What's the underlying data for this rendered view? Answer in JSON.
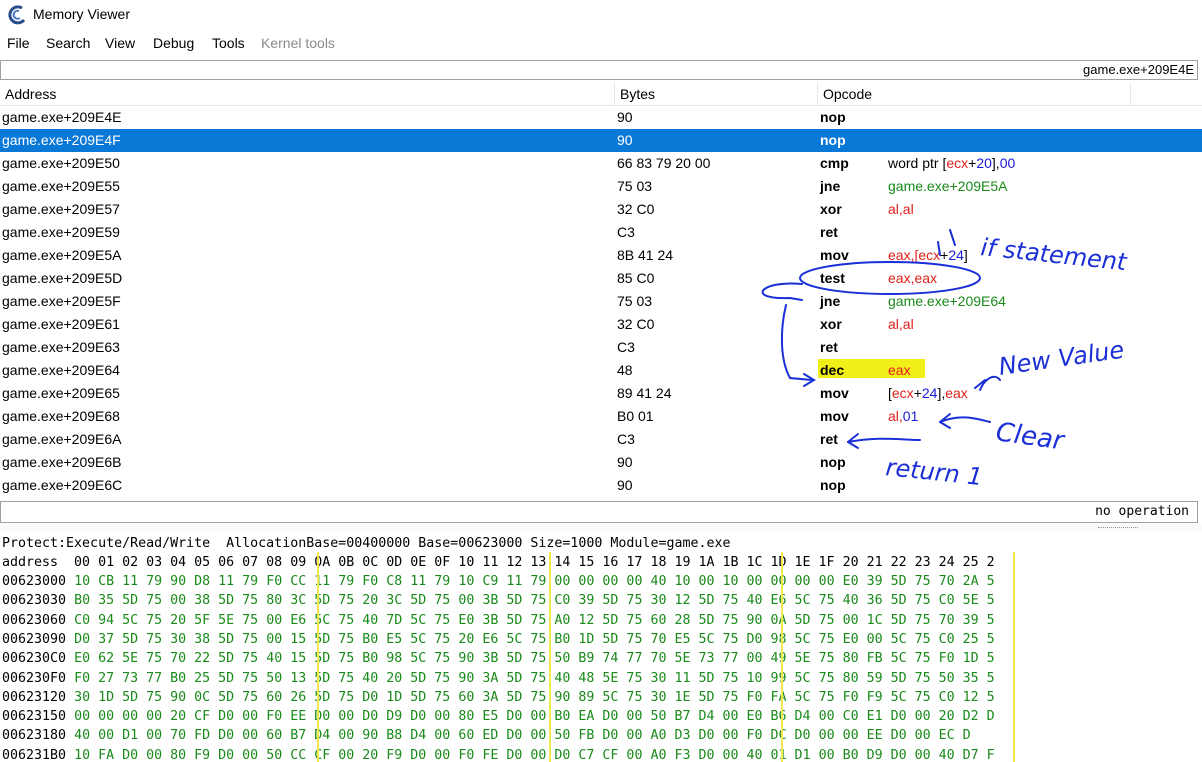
{
  "window": {
    "title": "Memory Viewer"
  },
  "menu": [
    "File",
    "Search",
    "View",
    "Debug",
    "Tools",
    "Kernel tools"
  ],
  "address_bar": {
    "value": "game.exe+209E4E"
  },
  "columns": {
    "address": "Address",
    "bytes": "Bytes",
    "opcode": "Opcode"
  },
  "disasm": [
    {
      "addr": "game.exe+209E4E",
      "bytes": "90",
      "op": "nop",
      "args": []
    },
    {
      "addr": "game.exe+209E4F",
      "bytes": "90",
      "op": "nop",
      "args": [],
      "selected": true
    },
    {
      "addr": "game.exe+209E50",
      "bytes": "66 83 79 20 00",
      "op": "cmp",
      "args": [
        {
          "t": "word ptr [",
          "c": ""
        },
        {
          "t": "ecx",
          "c": "red"
        },
        {
          "t": "+",
          "c": ""
        },
        {
          "t": "20",
          "c": "blue"
        },
        {
          "t": "],",
          "c": ""
        },
        {
          "t": "00",
          "c": "blue"
        }
      ]
    },
    {
      "addr": "game.exe+209E55",
      "bytes": "75 03",
      "op": "jne",
      "args": [
        {
          "t": "game.exe+209E5A",
          "c": "green"
        }
      ]
    },
    {
      "addr": "game.exe+209E57",
      "bytes": "32 C0",
      "op": "xor",
      "args": [
        {
          "t": "al,al",
          "c": "red"
        }
      ]
    },
    {
      "addr": "game.exe+209E59",
      "bytes": "C3",
      "op": "ret",
      "args": []
    },
    {
      "addr": "game.exe+209E5A",
      "bytes": "8B 41 24",
      "op": "mov",
      "args": [
        {
          "t": "eax,[",
          "c": "red"
        },
        {
          "t": "ecx",
          "c": "red"
        },
        {
          "t": "+",
          "c": ""
        },
        {
          "t": "24",
          "c": "blue"
        },
        {
          "t": "]",
          "c": ""
        }
      ]
    },
    {
      "addr": "game.exe+209E5D",
      "bytes": "85 C0",
      "op": "test",
      "args": [
        {
          "t": "eax,eax",
          "c": "red"
        }
      ]
    },
    {
      "addr": "game.exe+209E5F",
      "bytes": "75 03",
      "op": "jne",
      "args": [
        {
          "t": "game.exe+209E64",
          "c": "green"
        }
      ]
    },
    {
      "addr": "game.exe+209E61",
      "bytes": "32 C0",
      "op": "xor",
      "args": [
        {
          "t": "al,al",
          "c": "red"
        }
      ]
    },
    {
      "addr": "game.exe+209E63",
      "bytes": "C3",
      "op": "ret",
      "args": []
    },
    {
      "addr": "game.exe+209E64",
      "bytes": "48",
      "op": "dec",
      "args": [
        {
          "t": "eax",
          "c": "red"
        }
      ],
      "highlight": true
    },
    {
      "addr": "game.exe+209E65",
      "bytes": "89 41 24",
      "op": "mov",
      "args": [
        {
          "t": "[",
          "c": ""
        },
        {
          "t": "ecx",
          "c": "red"
        },
        {
          "t": "+",
          "c": ""
        },
        {
          "t": "24",
          "c": "blue"
        },
        {
          "t": "],",
          "c": ""
        },
        {
          "t": "eax",
          "c": "red"
        }
      ]
    },
    {
      "addr": "game.exe+209E68",
      "bytes": "B0 01",
      "op": "mov",
      "args": [
        {
          "t": "al,",
          "c": "red"
        },
        {
          "t": "01",
          "c": "blue"
        }
      ]
    },
    {
      "addr": "game.exe+209E6A",
      "bytes": "C3",
      "op": "ret",
      "args": []
    },
    {
      "addr": "game.exe+209E6B",
      "bytes": "90",
      "op": "nop",
      "args": []
    },
    {
      "addr": "game.exe+209E6C",
      "bytes": "90",
      "op": "nop",
      "args": []
    }
  ],
  "status": "no operation",
  "hex": {
    "info": "Protect:Execute/Read/Write  AllocationBase=00400000 Base=00623000 Size=1000 Module=game.exe",
    "header": "address  00 01 02 03 04 05 06 07 08 09 0A 0B 0C 0D 0E 0F 10 11 12 13 14 15 16 17 18 19 1A 1B 1C 1D 1E 1F 20 21 22 23 24 25 2",
    "rows": [
      {
        "addr": "00623000",
        "data": "10 CB 11 79 90 D8 11 79 F0 CC 11 79 F0 C8 11 79 10 C9 11 79 00 00 00 00 40 10 00 10 00 00 00 00 E0 39 5D 75 70 2A 5"
      },
      {
        "addr": "00623030",
        "data": "B0 35 5D 75 00 38 5D 75 80 3C 5D 75 20 3C 5D 75 00 3B 5D 75 C0 39 5D 75 30 12 5D 75 40 E6 5C 75 40 36 5D 75 C0 5E 5"
      },
      {
        "addr": "00623060",
        "data": "C0 94 5C 75 20 5F 5E 75 00 E6 5C 75 40 7D 5C 75 E0 3B 5D 75 A0 12 5D 75 60 28 5D 75 90 0A 5D 75 00 1C 5D 75 70 39 5"
      },
      {
        "addr": "00623090",
        "data": "D0 37 5D 75 30 38 5D 75 00 15 5D 75 B0 E5 5C 75 20 E6 5C 75 B0 1D 5D 75 70 E5 5C 75 D0 98 5C 75 E0 00 5C 75 C0 25 5"
      },
      {
        "addr": "006230C0",
        "data": "E0 62 5E 75 70 22 5D 75 40 15 5D 75 B0 98 5C 75 90 3B 5D 75 50 B9 74 77 70 5E 73 77 00 49 5E 75 80 FB 5C 75 F0 1D 5"
      },
      {
        "addr": "006230F0",
        "data": "F0 27 73 77 B0 25 5D 75 50 13 5D 75 40 20 5D 75 90 3A 5D 75 40 48 5E 75 30 11 5D 75 10 99 5C 75 80 59 5D 75 50 35 5"
      },
      {
        "addr": "00623120",
        "data": "30 1D 5D 75 90 0C 5D 75 60 26 5D 75 D0 1D 5D 75 60 3A 5D 75 90 89 5C 75 30 1E 5D 75 F0 FA 5C 75 F0 F9 5C 75 C0 12 5"
      },
      {
        "addr": "00623150",
        "data": "00 00 00 00 20 CF D0 00 F0 EE D0 00 D0 D9 D0 00 80 E5 D0 00 B0 EA D0 00 50 B7 D4 00 E0 B6 D4 00 C0 E1 D0 00 20 D2 D"
      },
      {
        "addr": "00623180",
        "data": "40 00 D1 00 70 FD D0 00 60 B7 D4 00 90 B8 D4 00 60 ED D0 00 50 FB D0 00 A0 D3 D0 00 F0 DC D0 00 00 EE D0 00 EC D"
      },
      {
        "addr": "006231B0",
        "data": "10 FA D0 00 80 F9 D0 00 50 CC CF 00 20 F9 D0 00 F0 FE D0 00 D0 C7 CF 00 A0 F3 D0 00 40 01 D1 00 B0 D9 D0 00 40 D7 F"
      }
    ]
  },
  "annotations": {
    "if_statement": "if statement",
    "new_value": "New Value",
    "clear": "Clear",
    "return": "return 1"
  },
  "colors": {
    "selection": "#0a78d7",
    "highlight": "#f2ee19",
    "register": "#e0201b",
    "number": "#1a1ad6",
    "target": "#1a8a1a",
    "ink": "#1b2fd6"
  }
}
